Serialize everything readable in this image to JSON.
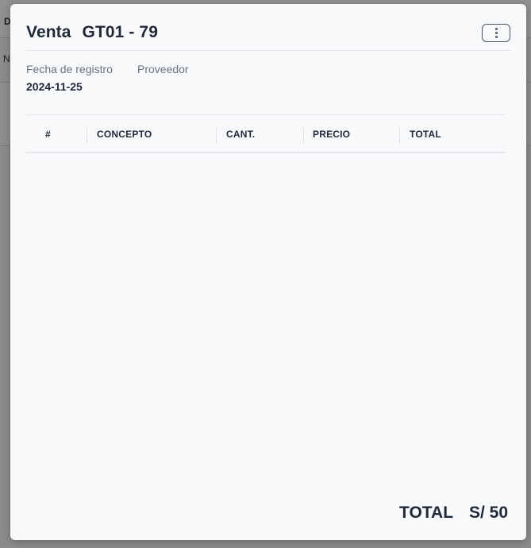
{
  "background": {
    "header_letter": "D",
    "row_letter": "N"
  },
  "modal": {
    "title_prefix": "Venta",
    "title_code": "GT01 - 79",
    "menu_icon": "kebab-menu-icon",
    "fields": {
      "fecha_label": "Fecha de registro",
      "proveedor_label": "Proveedor",
      "fecha_value": "2024-11-25",
      "proveedor_value": ""
    },
    "table": {
      "columns": [
        "#",
        "CONCEPTO",
        "CANT.",
        "PRECIO",
        "TOTAL"
      ],
      "rows": []
    },
    "total": {
      "label": "TOTAL",
      "value": "S/ 50"
    }
  },
  "colors": {
    "overlay": "#747475",
    "modal_bg": "#f8f9fb",
    "text_primary": "#1f2937",
    "text_secondary": "#6b7280",
    "divider": "#e3e6ea"
  }
}
